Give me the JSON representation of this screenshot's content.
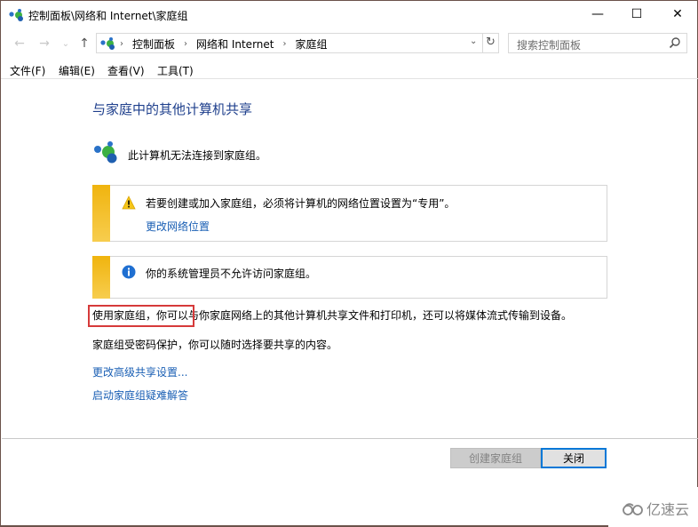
{
  "window": {
    "title": "控制面板\\网络和 Internet\\家庭组",
    "controls": {
      "minimize": "—",
      "maximize": "☐",
      "close": "✕"
    }
  },
  "nav": {
    "back": "←",
    "forward": "→",
    "recent": "⌄",
    "up": "↑",
    "breadcrumbs": [
      "控制面板",
      "网络和 Internet",
      "家庭组"
    ],
    "separator": "›",
    "dropdown": "⌄",
    "refresh": "↻",
    "search_placeholder": "搜索控制面板"
  },
  "menu": {
    "items": [
      "文件(F)",
      "编辑(E)",
      "查看(V)",
      "工具(T)"
    ]
  },
  "main": {
    "heading": "与家庭中的其他计算机共享",
    "status": "此计算机无法连接到家庭组。",
    "notices": [
      {
        "type": "warning",
        "text": "若要创建或加入家庭组，必须将计算机的网络位置设置为“专用”。",
        "link": "更改网络位置"
      },
      {
        "type": "info",
        "text": "你的系统管理员不允许访问家庭组。"
      }
    ],
    "paragraphs": [
      "使用家庭组，你可以与你家庭网络上的其他计算机共享文件和打印机，还可以将媒体流式传输到设备。",
      "家庭组受密码保护，你可以随时选择要共享的内容。"
    ],
    "links": [
      "更改高级共享设置...",
      "启动家庭组疑难解答"
    ]
  },
  "footer": {
    "create_button": "创建家庭组",
    "close_button": "关闭"
  },
  "watermark": "亿速云",
  "colors": {
    "heading": "#1e3f8c",
    "link": "#1a5fb4",
    "notice_bar": "#f0b40e",
    "highlight": "#d63a3a",
    "focus": "#0078d7"
  }
}
